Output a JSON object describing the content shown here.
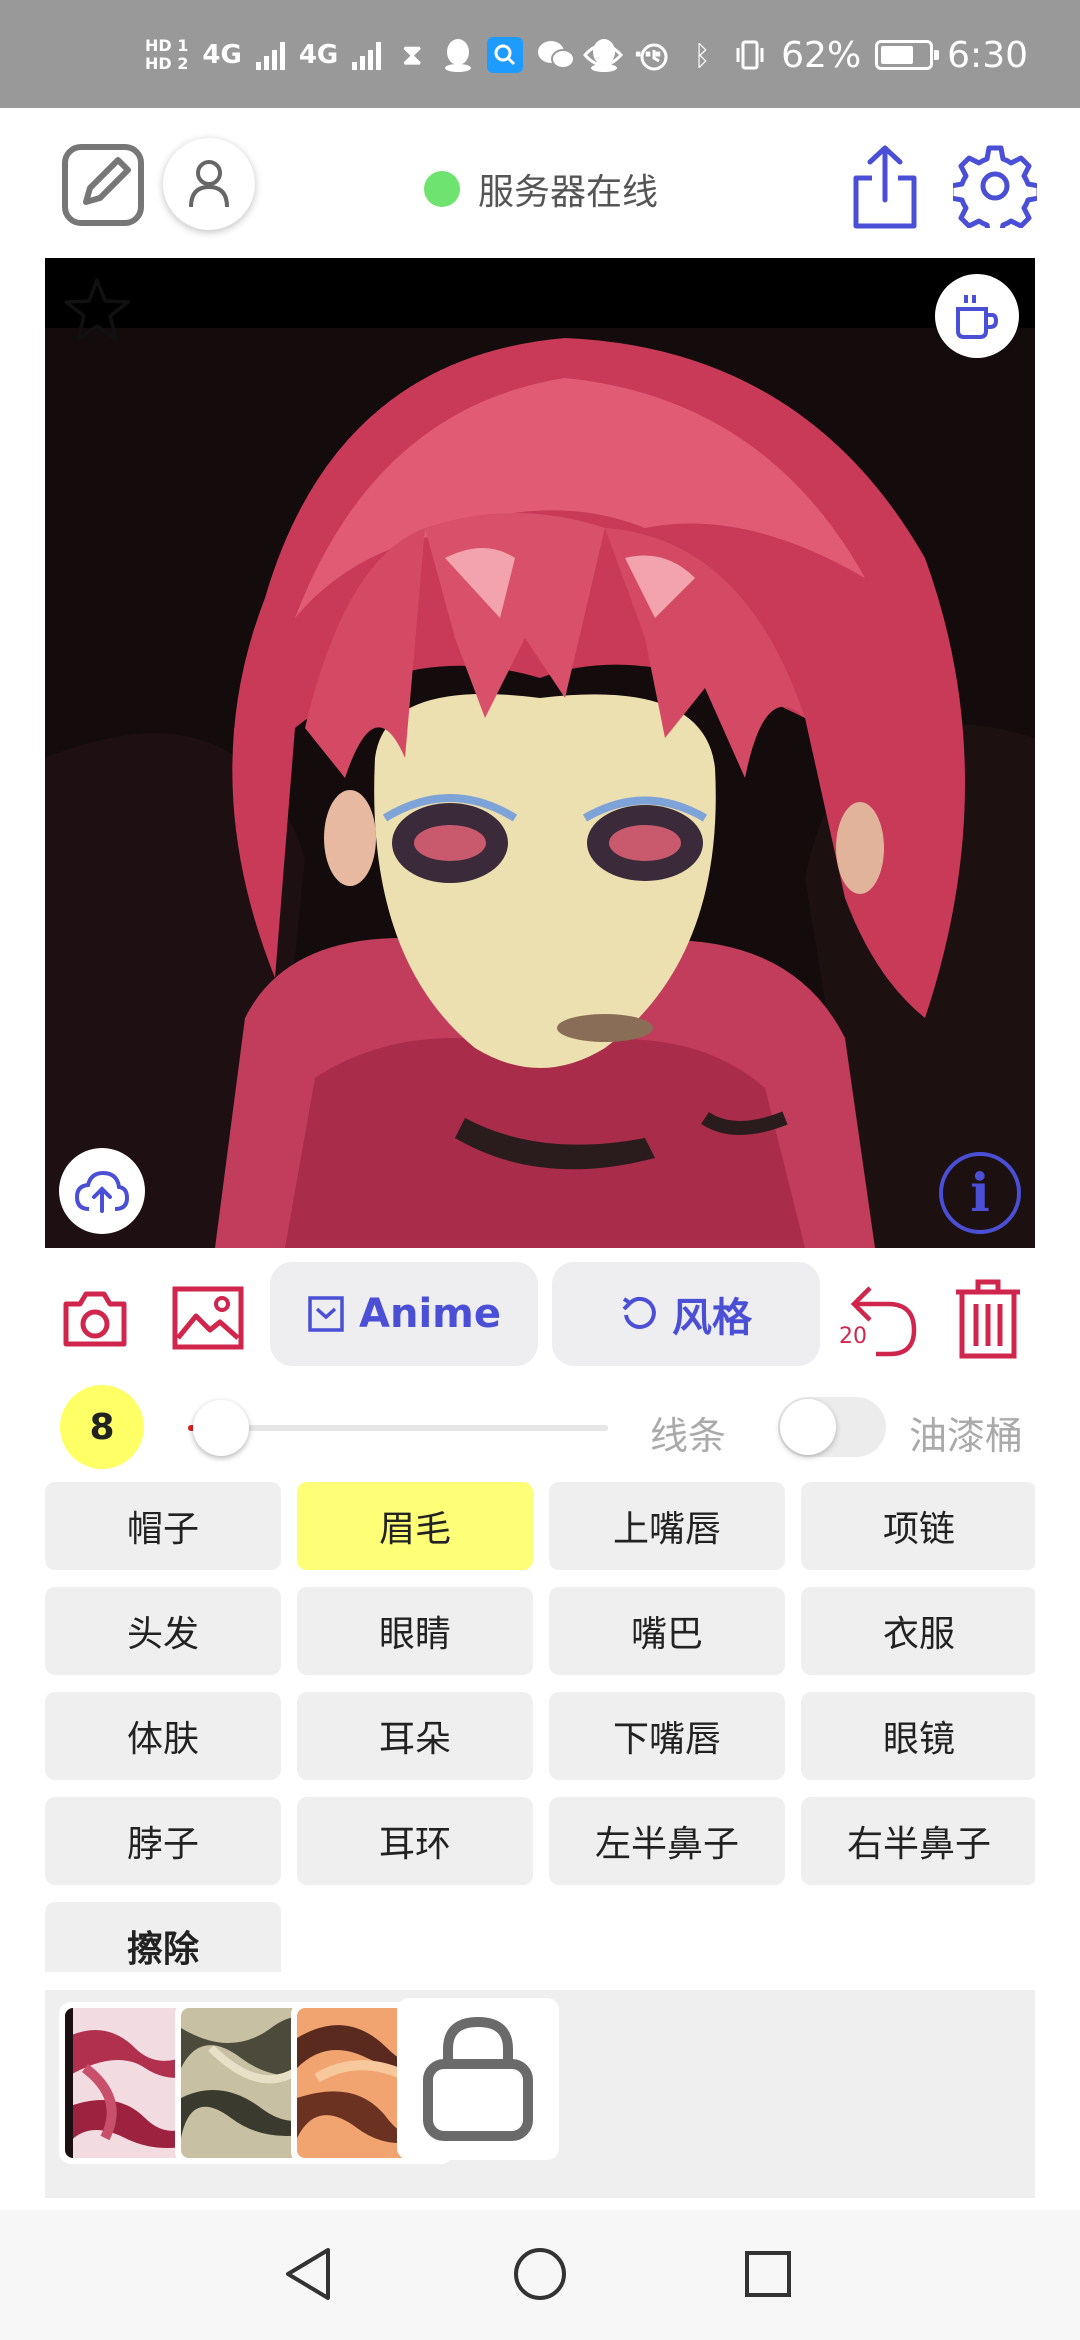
{
  "status_bar": {
    "hd1": "HD 1",
    "hd2": "HD 2",
    "net1": "4G",
    "net2": "4G",
    "overflow": "···",
    "battery": "62%",
    "time": "6:30",
    "colors": {
      "background": "#999999",
      "text": "#ffffff"
    }
  },
  "topbar": {
    "server_status": "服务器在线",
    "status_color": "#6fe36f",
    "icons": [
      "edit-icon",
      "user-icon",
      "share-icon",
      "gear-icon"
    ]
  },
  "canvas": {
    "icons": [
      "star-icon",
      "coffee-cup-icon",
      "cloud-upload-icon",
      "info-icon"
    ],
    "info_glyph": "i"
  },
  "toolbar": {
    "anime_label": "Anime",
    "style_label": "风格",
    "undo_count": "20",
    "accent": "#4a4fd6",
    "danger": "#d0264e"
  },
  "brush": {
    "size": "8",
    "slider_value": 0.06,
    "lines_label": "线条",
    "bucket_label": "油漆桶",
    "bucket_enabled": false
  },
  "parts": [
    {
      "label": "帽子",
      "selected": false
    },
    {
      "label": "眉毛",
      "selected": true
    },
    {
      "label": "上嘴唇",
      "selected": false
    },
    {
      "label": "项链",
      "selected": false
    },
    {
      "label": "头发",
      "selected": false
    },
    {
      "label": "眼睛",
      "selected": false
    },
    {
      "label": "嘴巴",
      "selected": false
    },
    {
      "label": "衣服",
      "selected": false
    },
    {
      "label": "体肤",
      "selected": false
    },
    {
      "label": "耳朵",
      "selected": false
    },
    {
      "label": "下嘴唇",
      "selected": false
    },
    {
      "label": "眼镜",
      "selected": false
    },
    {
      "label": "脖子",
      "selected": false
    },
    {
      "label": "耳环",
      "selected": false
    },
    {
      "label": "左半鼻子",
      "selected": false
    },
    {
      "label": "右半鼻子",
      "selected": false
    },
    {
      "label": "擦除",
      "selected": false
    }
  ],
  "textures": [
    "red-swirl-texture",
    "olive-swirl-texture",
    "orange-swirl-texture",
    "lock-icon"
  ],
  "nav": [
    "back-icon",
    "home-icon",
    "recent-apps-icon"
  ]
}
